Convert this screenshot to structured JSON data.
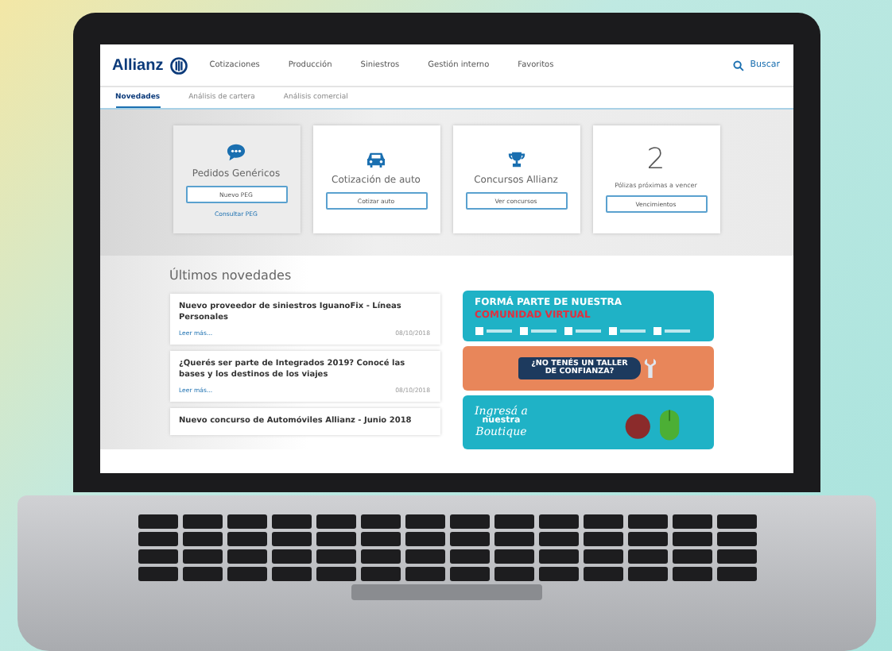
{
  "header": {
    "brand": "Allianz",
    "nav": [
      {
        "label": "Cotizaciones"
      },
      {
        "label": "Producción"
      },
      {
        "label": "Siniestros"
      },
      {
        "label": "Gestión interno"
      },
      {
        "label": "Favoritos"
      }
    ],
    "search": "Buscar"
  },
  "tabs": [
    {
      "label": "Novedades",
      "selected": true
    },
    {
      "label": "Análisis de cartera",
      "selected": false
    },
    {
      "label": "Análisis comercial",
      "selected": false
    }
  ],
  "cards": [
    {
      "kind": "chat",
      "title": "Pedidos Genéricos",
      "button": "Nuevo PEG",
      "link": "Consultar PEG",
      "highlighted": true
    },
    {
      "kind": "car",
      "title": "Cotización de auto",
      "button": "Cotizar auto",
      "highlighted": false
    },
    {
      "kind": "trophy",
      "title": "Concursos Allianz",
      "button": "Ver concursos",
      "highlighted": false
    },
    {
      "kind": "number",
      "number": "2",
      "title": "Pólizas próximas a vencer",
      "button": "Vencimientos",
      "highlighted": false
    }
  ],
  "news": {
    "heading": "Últimos novedades",
    "items": [
      {
        "title": "Nuevo proveedor de siniestros IguanoFix - Líneas Personales",
        "link": "Leer más...",
        "date": "08/10/2018"
      },
      {
        "title": "¿Querés ser parte de Integrados 2019? Conocé las bases y los destinos de los viajes",
        "link": "Leer más...",
        "date": "08/10/2018"
      },
      {
        "title": "Nuevo concurso de Automóviles Allianz - Junio 2018"
      }
    ]
  },
  "banners": [
    {
      "kind": "community",
      "line1": "FORMÁ PARTE DE NUESTRA",
      "line2": "COMUNIDAD VIRTUAL"
    },
    {
      "kind": "workshop",
      "line1": "¿NO TENÉS UN TALLER",
      "line2": "DE CONFIANZA?"
    },
    {
      "kind": "boutique",
      "line1": "Ingresá a",
      "line2": "nuestra",
      "line3": "Boutique"
    }
  ]
}
